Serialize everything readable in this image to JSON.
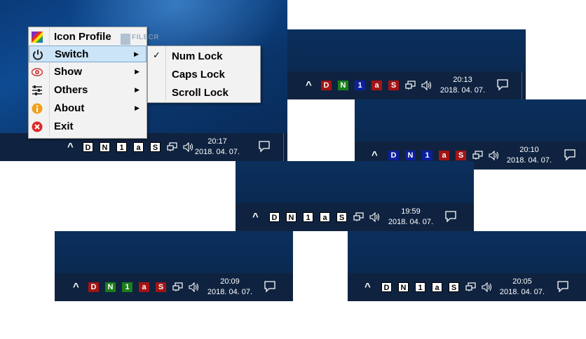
{
  "menu": {
    "items": [
      {
        "label": "Icon Profile",
        "icon": "color-palette-icon"
      },
      {
        "label": "Switch",
        "icon": "power-icon",
        "active": true
      },
      {
        "label": "Show",
        "icon": "eye-icon"
      },
      {
        "label": "Others",
        "icon": "sliders-icon"
      },
      {
        "label": "About",
        "icon": "info-icon"
      },
      {
        "label": "Exit",
        "icon": "close-circle-icon"
      }
    ]
  },
  "submenu": {
    "items": [
      {
        "label": "Num Lock",
        "checked": true
      },
      {
        "label": "Caps Lock",
        "checked": false
      },
      {
        "label": "Scroll Lock",
        "checked": false
      }
    ]
  },
  "watermark": {
    "text": "FILECR"
  },
  "taskbars": [
    {
      "time": "20:17",
      "date": "2018. 04. 07.",
      "badges": [
        "D",
        "N",
        "1",
        "a",
        "S"
      ],
      "states": [
        "off",
        "off",
        "off",
        "off",
        "off"
      ]
    },
    {
      "time": "20:13",
      "date": "2018. 04. 07.",
      "badges": [
        "D",
        "N",
        "1",
        "a",
        "S"
      ],
      "states": [
        "red",
        "green",
        "blue",
        "red",
        "red"
      ]
    },
    {
      "time": "20:10",
      "date": "2018. 04. 07.",
      "badges": [
        "D",
        "N",
        "1",
        "a",
        "S"
      ],
      "states": [
        "blue",
        "blue",
        "blue",
        "red",
        "red"
      ]
    },
    {
      "time": "19:59",
      "date": "2018. 04. 07.",
      "badges": [
        "D",
        "N",
        "1",
        "a",
        "S"
      ],
      "states": [
        "off",
        "off",
        "off",
        "off",
        "off"
      ]
    },
    {
      "time": "20:09",
      "date": "2018. 04. 07.",
      "badges": [
        "D",
        "N",
        "1",
        "a",
        "S"
      ],
      "states": [
        "red",
        "green",
        "green",
        "red",
        "red"
      ]
    },
    {
      "time": "20:05",
      "date": "2018. 04. 07.",
      "badges": [
        "D",
        "N",
        "1",
        "a",
        "S"
      ],
      "states": [
        "off",
        "off",
        "off",
        "off",
        "off"
      ]
    }
  ],
  "colors": {
    "red": "#a31414",
    "green": "#1b7d1b",
    "blue": "#0c1f9c",
    "taskbar": "#0f2340",
    "menu_highlight": "#cce4f7"
  }
}
